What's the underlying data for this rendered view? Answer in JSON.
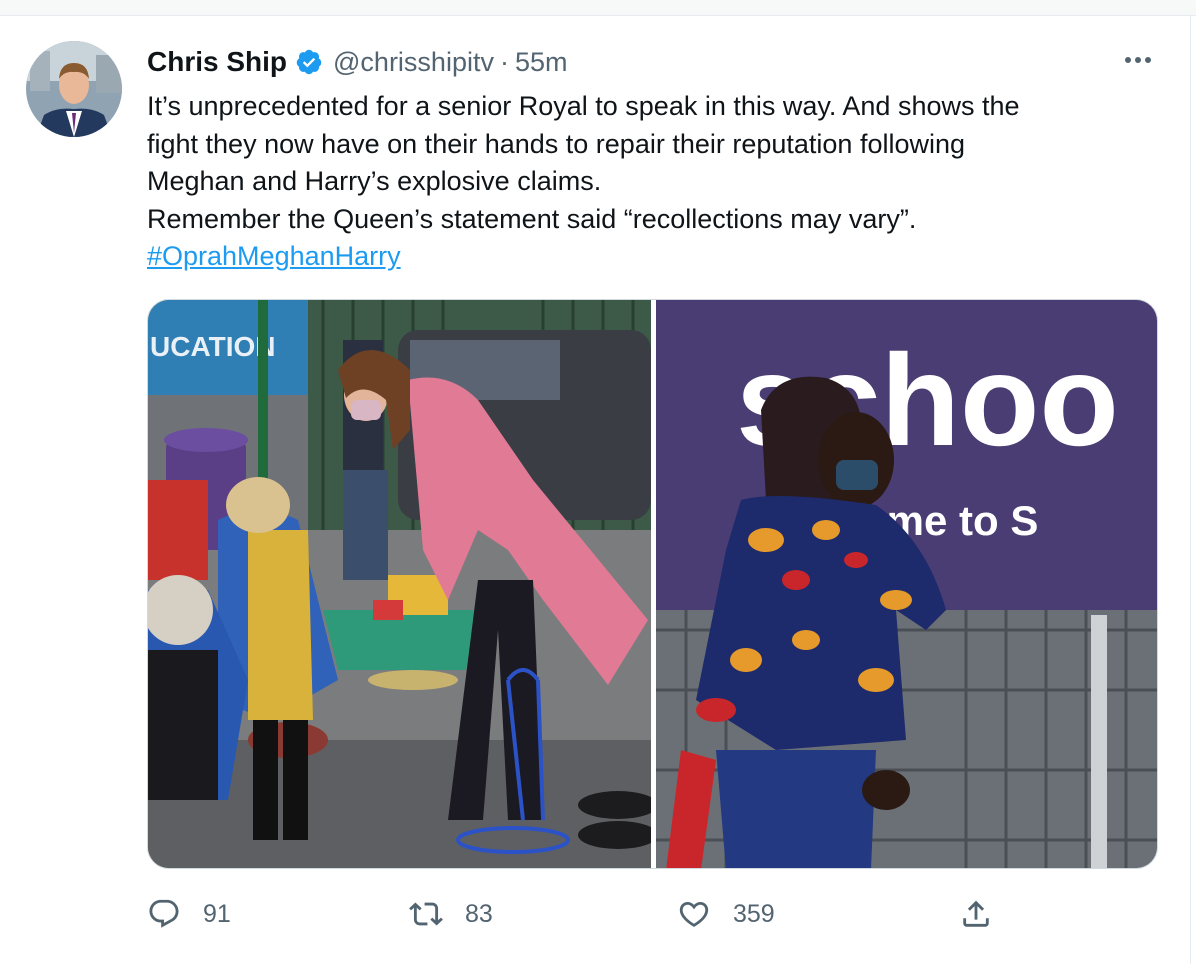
{
  "tweet": {
    "author_name": "Chris Ship",
    "handle": "@chrisshipitv",
    "separator": "·",
    "time": "55m",
    "text_lines": [
      "It’s unprecedented for a senior Royal to speak in this way. And shows the",
      "fight they now have on their hands to repair their reputation following",
      "Meghan and Harry’s explosive claims.",
      "Remember the Queen’s statement said “recollections may vary”."
    ],
    "hashtag": "#OprahMeghanHarry",
    "photos": {
      "left": {
        "banner_text": "UCATION"
      },
      "right": {
        "banner_text_large": "schoo",
        "banner_text_small": "lcome to S"
      }
    }
  },
  "actions": {
    "reply_count": "91",
    "retweet_count": "83",
    "like_count": "359"
  },
  "icons": {
    "verified": "verified-badge-icon",
    "more": "more-options-icon",
    "reply": "reply-icon",
    "retweet": "retweet-icon",
    "like": "heart-icon",
    "share": "share-icon"
  },
  "colors": {
    "text": "#0f1419",
    "secondary": "#536471",
    "link": "#1d9bf0",
    "verified": "#1d9bf0",
    "border": "#cfd9de"
  }
}
